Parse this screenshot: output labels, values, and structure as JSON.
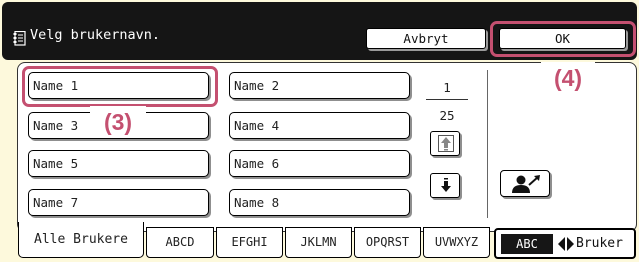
{
  "title_bar": {
    "icon": "address-book-icon",
    "title": "Velg brukernavn.",
    "cancel_label": "Avbryt",
    "ok_label": "OK"
  },
  "names": [
    "Name 1",
    "Name 2",
    "Name 3",
    "Name 4",
    "Name 5",
    "Name 6",
    "Name 7",
    "Name 8"
  ],
  "pager": {
    "current": "1",
    "total": "25",
    "up_icon": "arrow-up-icon",
    "down_icon": "arrow-down-icon"
  },
  "user_select_icon": "user-select-icon",
  "tabs": [
    "Alle Brukere",
    "ABCD",
    "EFGHI",
    "JKLMN",
    "OPQRST",
    "UVWXYZ"
  ],
  "toggle": {
    "selected": "ABC",
    "other": "Bruker",
    "icon": "swap-arrows-icon"
  },
  "callouts": {
    "names_label": "(3)",
    "ok_label": "(4)"
  },
  "colors": {
    "title_bar_bg": "#151515",
    "panel_bg": "#fdf9dc",
    "callout": "#c45070"
  }
}
